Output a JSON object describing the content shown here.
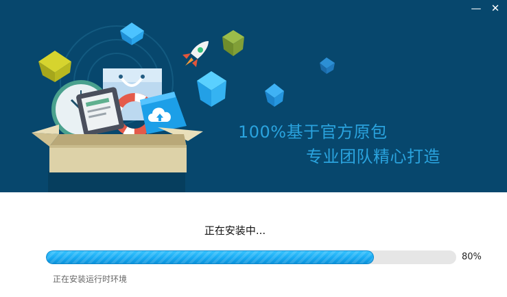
{
  "window": {
    "minimize_glyph": "—",
    "close_glyph": "✕"
  },
  "banner": {
    "slogan_line1": "100%基于官方原包",
    "slogan_line2": "专业团队精心打造",
    "illustration_icons": [
      "open-box-icon",
      "clock-icon",
      "tablet-icon",
      "shopping-bag-icon",
      "cloud-upload-icon",
      "lifebuoy-icon",
      "rocket-icon",
      "cube-icon"
    ]
  },
  "install": {
    "status_text": "正在安装中...",
    "progress_fraction": 0.8,
    "progress_percent": "80%",
    "detail_text": "正在安装运行时环境"
  },
  "colors": {
    "banner_bg": "#07476d",
    "slogan": "#2aa3de",
    "progress_fill": "#16a9f2",
    "progress_track": "#e6e6e6"
  }
}
